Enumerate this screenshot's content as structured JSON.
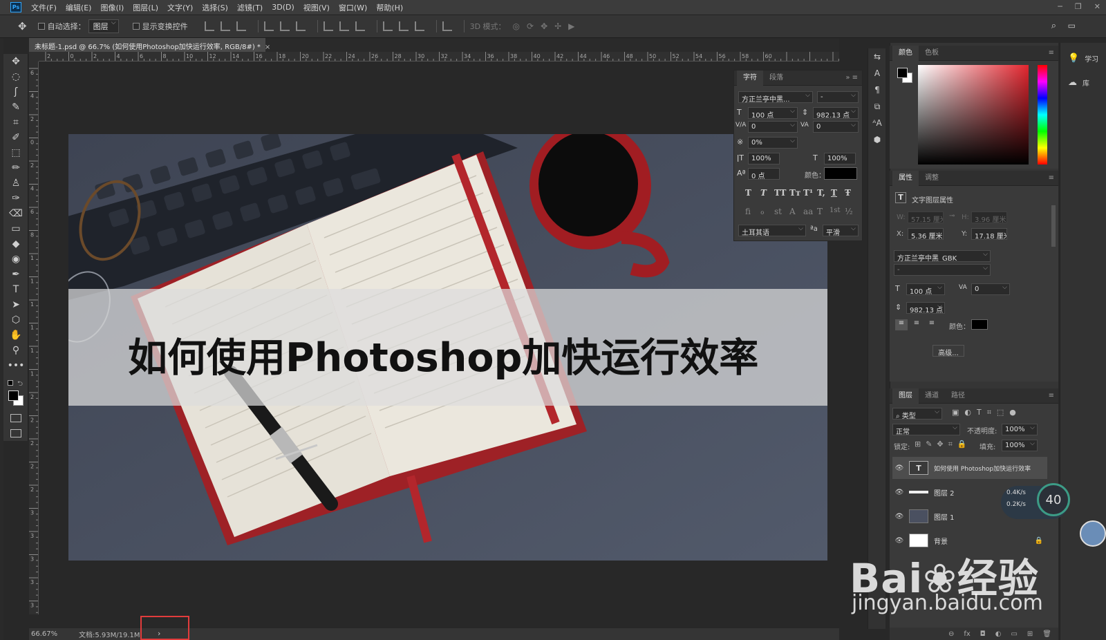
{
  "app": {
    "logo": "Ps",
    "menu": [
      "文件(F)",
      "编辑(E)",
      "图像(I)",
      "图层(L)",
      "文字(Y)",
      "选择(S)",
      "滤镜(T)",
      "3D(D)",
      "视图(V)",
      "窗口(W)",
      "帮助(H)"
    ],
    "window_controls": [
      "─",
      "❐",
      "✕"
    ]
  },
  "options_bar": {
    "move_icon": "✥",
    "auto_select_label": "自动选择：",
    "auto_select_value": "图层",
    "show_transform_label": "显示变换控件",
    "mode_3d_label": "3D 模式："
  },
  "document": {
    "tab_title": "未标题-1.psd @ 66.7% (如何使用Photoshop加快运行效率, RGB/8#) *",
    "tab_close": "×",
    "heading": "如何使用Photoshop加快运行效率"
  },
  "ruler_h_ticks": [
    "2",
    "0",
    "2",
    "4",
    "6",
    "8",
    "10",
    "12",
    "14",
    "16",
    "18",
    "20",
    "22",
    "24",
    "26",
    "28",
    "30",
    "32",
    "34",
    "36",
    "38",
    "40",
    "42",
    "44",
    "46",
    "48",
    "50",
    "52",
    "54",
    "56",
    "58",
    "60"
  ],
  "ruler_v_ticks": [
    "6",
    "4",
    "2",
    "0",
    "2",
    "4",
    "6",
    "8",
    "1",
    "1",
    "1",
    "1",
    "1",
    "1",
    "2",
    "2",
    "2",
    "2",
    "2",
    "3",
    "3",
    "3",
    "3",
    "3"
  ],
  "status": {
    "zoom": "66.67%",
    "doc_info": "文档:5.93M/19.1M",
    "arrow": "›"
  },
  "tools": [
    "✥",
    "◌",
    "ʃ",
    "✎",
    "⌗",
    "✐",
    "⬚",
    "✏",
    "♙",
    "✑",
    "⌫",
    "▭",
    "◆",
    "◉",
    "✒",
    "T",
    "➤",
    "⬡",
    "✋",
    "⚲",
    "•••"
  ],
  "character_panel": {
    "tabs": [
      "字符",
      "段落"
    ],
    "menu": "»  ≡",
    "font_family": "方正兰亭中黑...",
    "font_style": "-",
    "size": "100 点",
    "leading": "982.13 点",
    "kerning": "0",
    "tracking": "0",
    "scale_pct": "0%",
    "v_scale": "100%",
    "h_scale": "100%",
    "baseline": "0 点",
    "color_label": "颜色：",
    "style_buttons": [
      "T",
      "T",
      "TT",
      "Tт",
      "T¹",
      "T,",
      "T",
      "Ŧ"
    ],
    "opentype_buttons": [
      "fi",
      "ℴ",
      "st",
      "A",
      "aa",
      "T",
      "1st",
      "½"
    ],
    "language": "土耳其语",
    "aa_label": "ªa",
    "antialias": "平滑"
  },
  "dock_icons": [
    "⇆",
    "A",
    "¶",
    "⧉",
    "ᴬA",
    "⬢"
  ],
  "color_panel": {
    "tabs": [
      "颜色",
      "色板"
    ],
    "menu": "≡"
  },
  "properties_panel": {
    "tabs": [
      "属性",
      "调整"
    ],
    "menu": "≡",
    "title": "文字图层属性",
    "w_label": "W:",
    "w_value": "57.15 厘米",
    "h_label": "H:",
    "h_value": "3.96 厘米",
    "x_label": "X:",
    "x_value": "5.36 厘米",
    "y_label": "Y:",
    "y_value": "17.18 厘米",
    "font_family": "方正兰亭中黑_GBK",
    "font_style": "-",
    "size": "100 点",
    "tracking": "0",
    "leading": "982.13 点",
    "color_label": "颜色：",
    "advanced_button": "高级..."
  },
  "layers_panel": {
    "tabs": [
      "图层",
      "通道",
      "路径"
    ],
    "menu": "≡",
    "filter_label": "⌕ 类型",
    "blend_mode": "正常",
    "opacity_label": "不透明度:",
    "opacity_value": "100%",
    "lock_label": "锁定:",
    "fill_label": "填充:",
    "fill_value": "100%",
    "layers": [
      {
        "name": "如何使用 Photoshop加快运行效率",
        "thumb": "T"
      },
      {
        "name": "图层 2",
        "thumb": ""
      },
      {
        "name": "图层 1",
        "thumb": ""
      },
      {
        "name": "背景",
        "thumb": ""
      }
    ],
    "footer_icons": [
      "⊖",
      "fx",
      "◘",
      "◐",
      "▭",
      "⊞",
      "🗑"
    ]
  },
  "far_right": {
    "learn": "学习",
    "library": "库"
  },
  "net_widget": {
    "up": "0.4K/s",
    "down": "0.2K/s",
    "percent": "40"
  },
  "watermark": {
    "logo": "Bai❀经验",
    "url": "jingyan.baidu.com"
  }
}
